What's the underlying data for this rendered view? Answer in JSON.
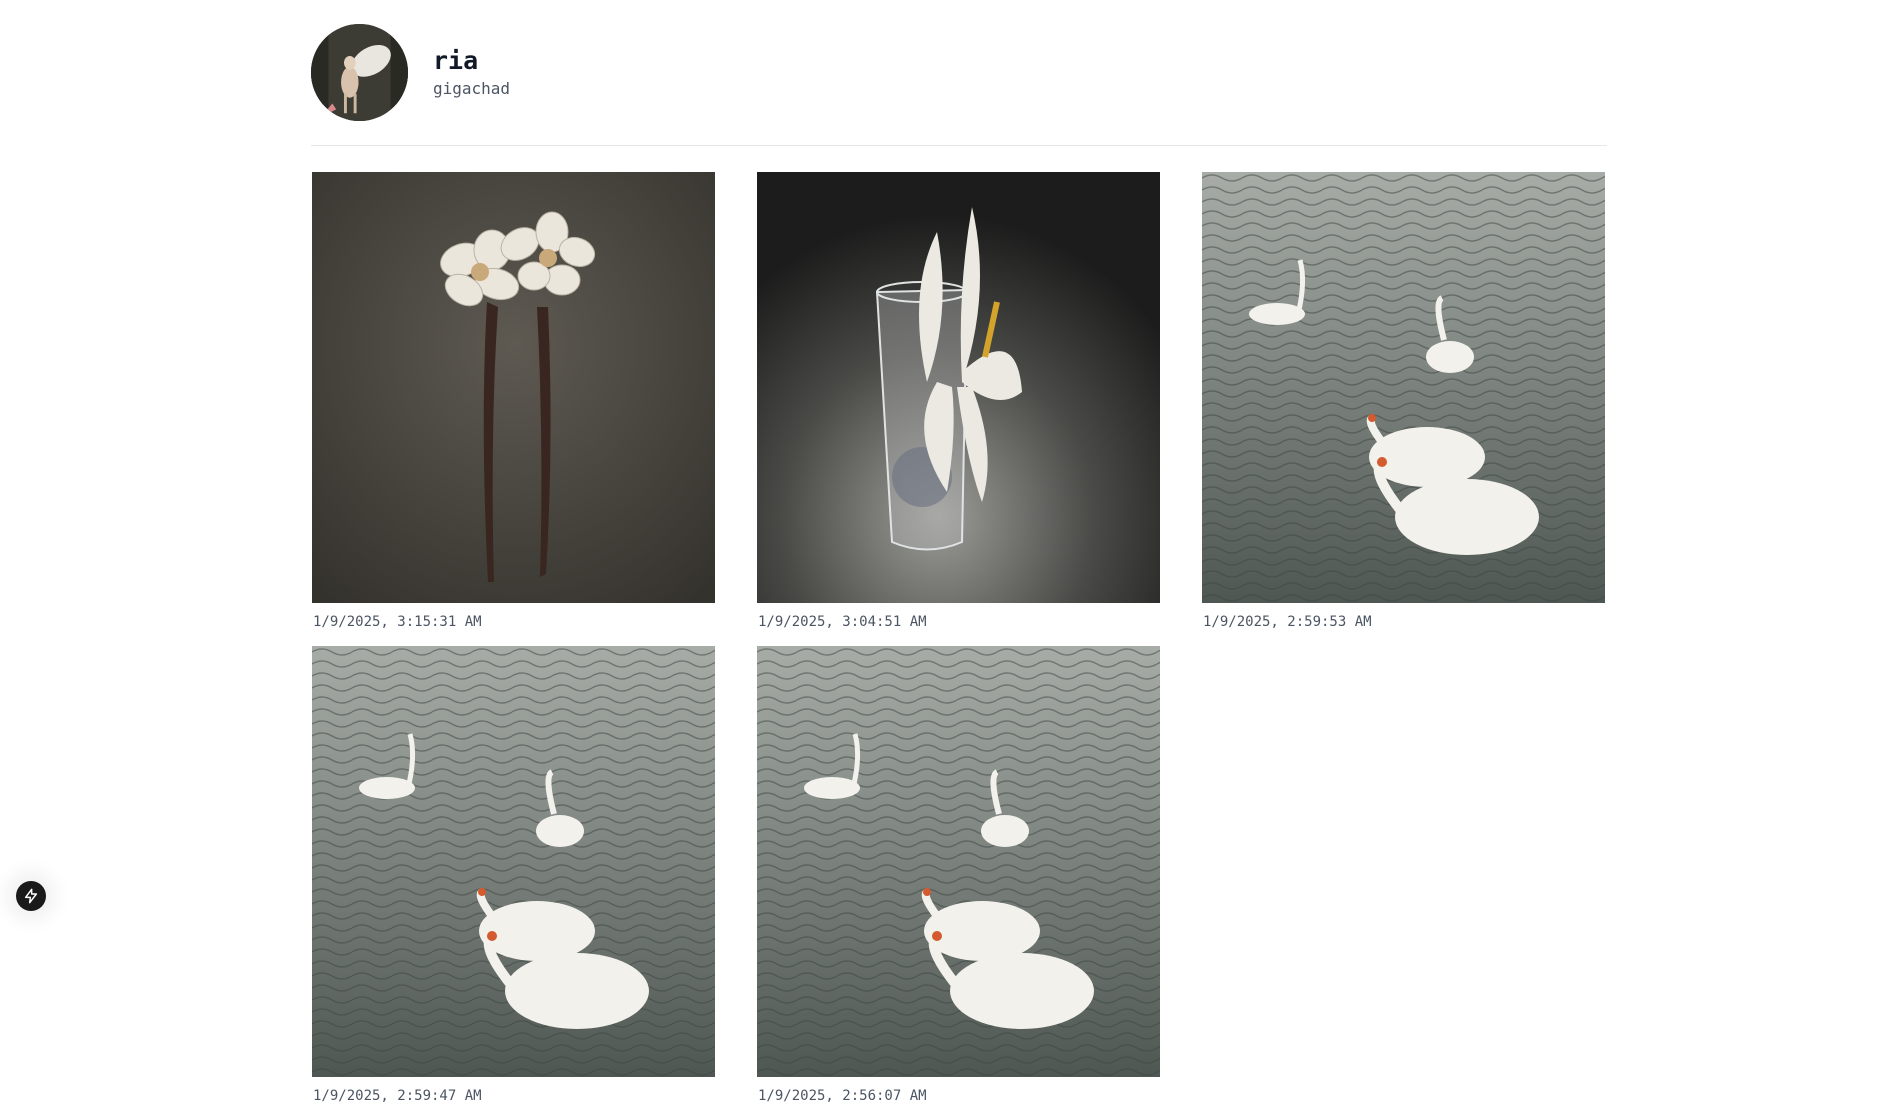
{
  "profile": {
    "name": "ria",
    "username": "gigachad"
  },
  "posts": [
    {
      "timestamp": "1/9/2025, 3:15:31 AM",
      "subject": "flower-hairpin"
    },
    {
      "timestamp": "1/9/2025, 3:04:51 AM",
      "subject": "flower-in-glass"
    },
    {
      "timestamp": "1/9/2025, 2:59:53 AM",
      "subject": "swans"
    },
    {
      "timestamp": "1/9/2025, 2:59:47 AM",
      "subject": "swans"
    },
    {
      "timestamp": "1/9/2025, 2:56:07 AM",
      "subject": "swans"
    }
  ],
  "fab": {
    "icon": "lightning-icon"
  }
}
